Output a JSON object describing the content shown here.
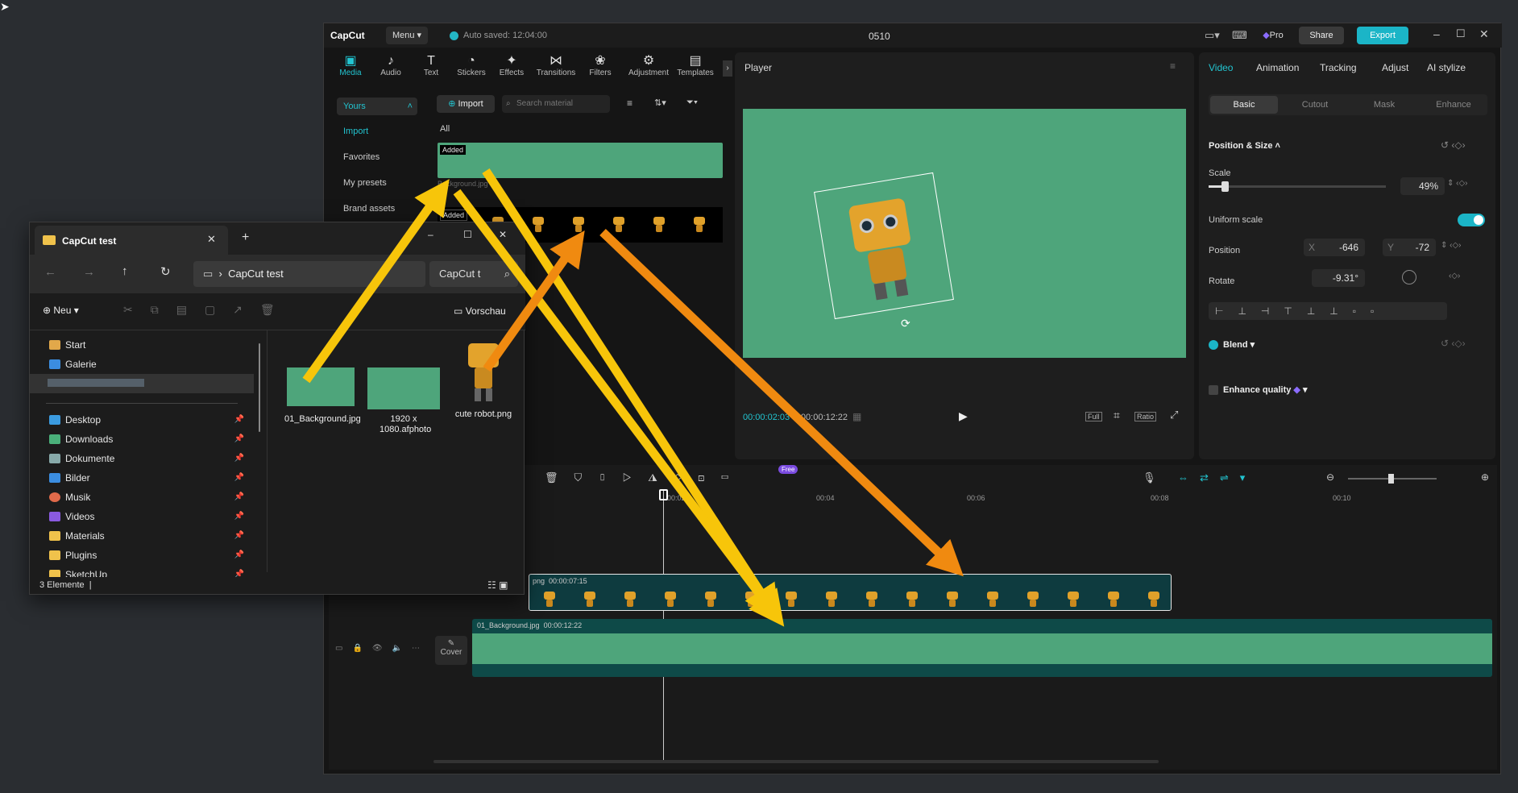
{
  "capcut": {
    "logo": "CapCut",
    "menu": "Menu",
    "autosave": "Auto saved: 12:04:00",
    "project": "0510",
    "pro": "Pro",
    "share": "Share",
    "export": "Export",
    "tools": [
      "Media",
      "Audio",
      "Text",
      "Stickers",
      "Effects",
      "Transitions",
      "Filters",
      "Adjustment",
      "Templates"
    ],
    "media_sidebar": {
      "yours": "Yours",
      "items": [
        "Import",
        "Favorites",
        "My presets",
        "Brand assets"
      ]
    },
    "import_btn": "Import",
    "search_placeholder": "Search material",
    "filter_all": "All",
    "added_badge": "Added",
    "added_badge2": "Added",
    "asset_caption": "Background.jpg",
    "player": {
      "title": "Player",
      "time_current": "00:00:02:03",
      "time_total": "00:00:12:22",
      "full": "Full",
      "ratio": "Ratio"
    },
    "inspector": {
      "tabs": [
        "Video",
        "Animation",
        "Tracking",
        "Adjust",
        "AI stylize"
      ],
      "subtabs": [
        "Basic",
        "Cutout",
        "Mask",
        "Enhance"
      ],
      "section": "Position & Size",
      "scale_label": "Scale",
      "scale_value": "49%",
      "uniform_label": "Uniform scale",
      "position_label": "Position",
      "pos_x_label": "X",
      "pos_x": "-646",
      "pos_y_label": "Y",
      "pos_y": "-72",
      "rotate_label": "Rotate",
      "rotate_value": "-9.31°",
      "blend_label": "Blend",
      "enhance_label": "Enhance quality"
    },
    "timeline": {
      "free_badge": "Free",
      "ticks": [
        "00:02",
        "00:04",
        "00:06",
        "00:08",
        "00:10"
      ],
      "clip1_name": "png",
      "clip1_duration": "00:00:07:15",
      "clip2_name": "01_Background.jpg",
      "clip2_duration": "00:00:12:22",
      "cover": "Cover"
    }
  },
  "explorer": {
    "tab_title": "CapCut test",
    "new_tab": "+",
    "path": "CapCut test",
    "search": "CapCut t",
    "new_btn": "Neu",
    "preview": "Vorschau",
    "quick": [
      "Start",
      "Galerie"
    ],
    "pinned": [
      "Desktop",
      "Downloads",
      "Dokumente",
      "Bilder",
      "Musik",
      "Videos",
      "Materials",
      "Plugins",
      "SketchUp"
    ],
    "files": [
      "01_Background.jpg",
      "1920 x 1080.afphoto",
      "cute robot.png"
    ],
    "status": "3 Elemente"
  }
}
